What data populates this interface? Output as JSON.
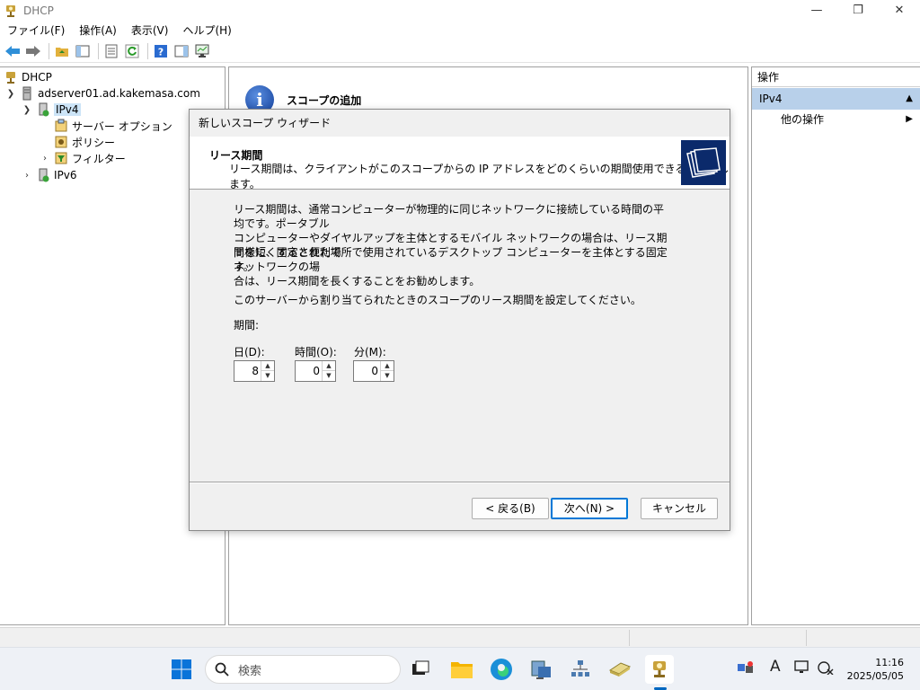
{
  "window": {
    "title": "DHCP",
    "minimize": "—",
    "maximize": "❐",
    "close": "✕"
  },
  "menu": [
    "ファイル(F)",
    "操作(A)",
    "表示(V)",
    "ヘルプ(H)"
  ],
  "tree": {
    "root": "DHCP",
    "server": "adserver01.ad.kakemasa.com",
    "ipv4": "IPv4",
    "server_options": "サーバー オプション",
    "policies": "ポリシー",
    "filters": "フィルター",
    "ipv6": "IPv6"
  },
  "center": {
    "title": "スコープの追加"
  },
  "actions": {
    "header": "操作",
    "section": "IPv4",
    "other": "他の操作"
  },
  "dialog": {
    "title": "新しいスコープ ウィザード",
    "header_title": "リース期間",
    "header_desc": "リース期間は、クライアントがこのスコープからの IP アドレスをどのくらいの期間使用できるかを示します。",
    "para1_line1": "リース期間は、通常コンピューターが物理的に同じネットワークに接続している時間の平均です。ポータブル",
    "para1_line2": "コンピューターやダイヤルアップを主体とするモバイル ネットワークの場合は、リース期間を短くすると便利で",
    "para1_line3": "す。",
    "para2_line1": "同様に、固定された場所で使用されているデスクトップ コンピューターを主体とする固定ネットワークの場",
    "para2_line2": "合は、リース期間を長くすることをお勧めします。",
    "instruction": "このサーバーから割り当てられたときのスコープのリース期間を設定してください。",
    "period_label": "期間:",
    "days_label": "日(D):",
    "hours_label": "時間(O):",
    "minutes_label": "分(M):",
    "days_value": "8",
    "hours_value": "0",
    "minutes_value": "0",
    "back_button": "< 戻る(B)",
    "next_button": "次へ(N) >",
    "cancel_button": "キャンセル"
  },
  "taskbar": {
    "search_placeholder": "検索",
    "time": "11:16",
    "date": "2025/05/05",
    "ime": "A"
  },
  "colors": {
    "selection": "#cce4f7",
    "action_section": "#b8d0ea",
    "accent": "#0078d7",
    "wizard_icon_bg": "#0b2a6b"
  }
}
